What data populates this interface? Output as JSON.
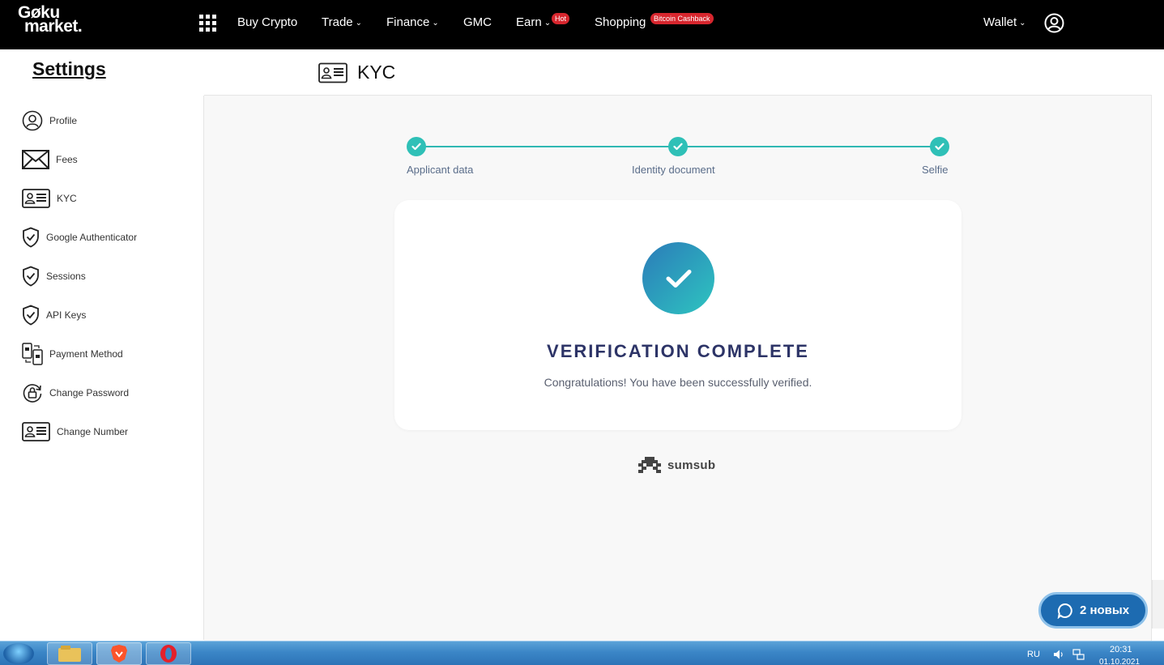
{
  "navbar": {
    "logo_line1": "Gøku",
    "logo_line2": "market.",
    "items": {
      "buy_crypto": "Buy Crypto",
      "trade": "Trade",
      "finance": "Finance",
      "gmc": "GMC",
      "earn": "Earn",
      "shopping": "Shopping",
      "wallet": "Wallet"
    },
    "badges": {
      "earn": "Hot",
      "shopping": "Bitcoin Cashback"
    },
    "icons": [
      "apps-grid-icon",
      "chevron-down-icon",
      "user-circle-icon"
    ],
    "colors": {
      "background": "#000000",
      "badge": "#d7262e"
    }
  },
  "sidebar": {
    "title": "Settings",
    "items": [
      {
        "label": "Profile",
        "icon": "user-circle-icon"
      },
      {
        "label": "Fees",
        "icon": "envelope-icon"
      },
      {
        "label": "KYC",
        "icon": "id-card-icon"
      },
      {
        "label": "Google Authenticator",
        "icon": "shield-check-icon"
      },
      {
        "label": "Sessions",
        "icon": "shield-check-icon"
      },
      {
        "label": "API Keys",
        "icon": "shield-check-icon"
      },
      {
        "label": "Payment Method",
        "icon": "phone-transfer-icon"
      },
      {
        "label": "Change Password",
        "icon": "lock-refresh-icon"
      },
      {
        "label": "Change Number",
        "icon": "id-card-icon"
      }
    ]
  },
  "main": {
    "title": "KYC",
    "steps": [
      {
        "label": "Applicant data",
        "status": "complete"
      },
      {
        "label": "Identity document",
        "status": "complete"
      },
      {
        "label": "Selfie",
        "status": "complete"
      }
    ],
    "card": {
      "title": "VERIFICATION COMPLETE",
      "subtitle": "Congratulations! You have been successfully verified."
    },
    "provider": "sumsub",
    "colors": {
      "accent": "#2fc0b7",
      "title": "#2d3467",
      "gradient_start": "#2b7bb9",
      "gradient_end": "#2ec5c0"
    }
  },
  "chat_widget": {
    "label": "2 новых",
    "icon": "chat-bubble-icon",
    "color": "#1d6bb1"
  },
  "taskbar": {
    "apps": [
      "windows-start-icon",
      "file-explorer-icon",
      "brave-browser-icon",
      "opera-browser-icon"
    ],
    "language": "RU",
    "time": "20:31",
    "date": "01.10.2021",
    "tray_icons": [
      "volume-icon",
      "network-icon"
    ]
  }
}
